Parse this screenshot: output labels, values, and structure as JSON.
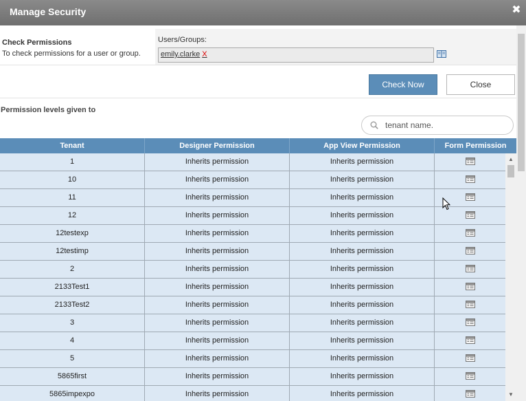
{
  "dialog": {
    "title": "Manage Security",
    "close_glyph": "✖"
  },
  "check": {
    "title": "Check Permissions",
    "description": "To check permissions for a user or group.",
    "users_label": "Users/Groups:",
    "selected_user": "emily.clarke",
    "remove_glyph": "X",
    "book_icon": "address-book-icon"
  },
  "buttons": {
    "check_now": "Check Now",
    "close": "Close"
  },
  "permissions": {
    "label": "Permission levels given to",
    "search_placeholder": "tenant name."
  },
  "table": {
    "headers": [
      "Tenant",
      "Designer Permission",
      "App View Permission",
      "Form Permission"
    ],
    "rows": [
      {
        "tenant": "1",
        "designer": "Inherits permission",
        "appview": "Inherits permission"
      },
      {
        "tenant": "10",
        "designer": "Inherits permission",
        "appview": "Inherits permission"
      },
      {
        "tenant": "11",
        "designer": "Inherits permission",
        "appview": "Inherits permission"
      },
      {
        "tenant": "12",
        "designer": "Inherits permission",
        "appview": "Inherits permission"
      },
      {
        "tenant": "12testexp",
        "designer": "Inherits permission",
        "appview": "Inherits permission"
      },
      {
        "tenant": "12testimp",
        "designer": "Inherits permission",
        "appview": "Inherits permission"
      },
      {
        "tenant": "2",
        "designer": "Inherits permission",
        "appview": "Inherits permission"
      },
      {
        "tenant": "2133Test1",
        "designer": "Inherits permission",
        "appview": "Inherits permission"
      },
      {
        "tenant": "2133Test2",
        "designer": "Inherits permission",
        "appview": "Inherits permission"
      },
      {
        "tenant": "3",
        "designer": "Inherits permission",
        "appview": "Inherits permission"
      },
      {
        "tenant": "4",
        "designer": "Inherits permission",
        "appview": "Inherits permission"
      },
      {
        "tenant": "5",
        "designer": "Inherits permission",
        "appview": "Inherits permission"
      },
      {
        "tenant": "5865first",
        "designer": "Inherits permission",
        "appview": "Inherits permission"
      },
      {
        "tenant": "5865impexpo",
        "designer": "Inherits permission",
        "appview": "Inherits permission"
      }
    ]
  },
  "colors": {
    "header_bg": "#5b8db8",
    "row_bg": "#dce8f4",
    "titlebar_bg": "#777777",
    "remove_red": "#dd0000"
  }
}
